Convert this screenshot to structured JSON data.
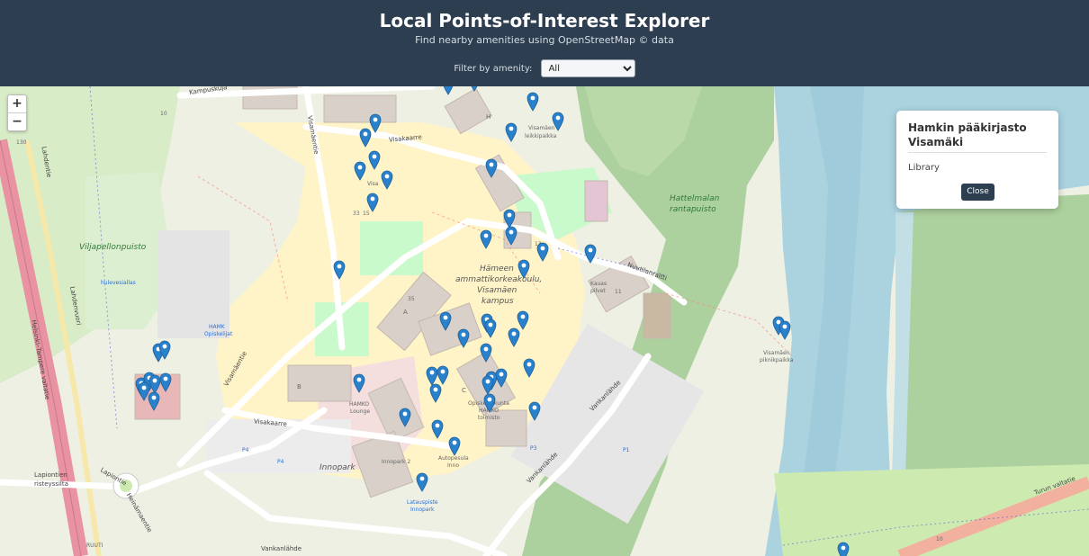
{
  "header": {
    "title": "Local Points-of-Interest Explorer",
    "subtitle": "Find nearby amenities using OpenStreetMap © data",
    "filter_label": "Filter by amenity:",
    "filter_value": "All"
  },
  "map": {
    "zoom_in": "+",
    "zoom_out": "−",
    "area_labels": {
      "viljapellonpuisto": "Viljapellonpuisto",
      "hattelmalan_1": "Hattelmalan",
      "hattelmalan_2": "rantapuisto",
      "hamk_1": "Hämeen",
      "hamk_2": "ammattikorkeakoulu,",
      "hamk_3": "Visamäen",
      "hamk_4": "kampus",
      "innopark": "Innopark",
      "lapiontien_1": "Lapiontien",
      "lapiontien_2": "risteyssilta"
    },
    "road_labels": {
      "kampuskuja": "Kampuskuja",
      "visakaarre_top": "Visakaarre",
      "visakaarre_bottom": "Visakaarre",
      "visamaentie_left": "Visamäentie",
      "visamaentie_top": "Visamäentie",
      "vankanlahde_1": "Vankanlähde",
      "vankanlahde_2": "Vankanlähde",
      "vankanlahde_3": "Vankanlähde",
      "nuutilanraitti": "Nuutilanraitti",
      "turun_valtatie": "Turun valtatie",
      "lahdentie": "Lahdentie",
      "lahdenvuori": "Lahdenvuori",
      "helsinki_tampere": "Helsinki–Tampere valtatie",
      "lapiontie": "Lapiontie",
      "heinamaentie": "Heinämaentie"
    },
    "small_labels": {
      "visamaen_leikkipaikka_1": "Visamäen",
      "visamaen_leikkipaikka_2": "leikkipaikka",
      "visamaen_piknikpaikka_1": "Visamäen",
      "visamaen_piknikpaikka_2": "piknikpaikka",
      "hamko_lounge_1": "HAMKO",
      "hamko_lounge_2": "Lounge",
      "hamk_opiskelijat_1": "HAMK",
      "hamk_opiskelijat_2": "Opiskelijat",
      "kauas_pilvet_1": "Kauas",
      "kauas_pilvet_2": "pilvet",
      "autopesula_1": "Autopesula",
      "autopesula_2": "Inno",
      "opiskelijakunta_1": "Opiskelijakunta",
      "opiskelijakunta_2": "HAMKO",
      "opiskelijakunta_3": "toimisto",
      "latauspiste_1": "Latauspiste",
      "latauspiste_2": "Innopark",
      "hulevesiallas": "hulevesiallas",
      "p1": "P1",
      "p3": "P3",
      "p4a": "P4",
      "p4b": "P4",
      "number_130": "130",
      "number_10a": "10",
      "number_10b": "10",
      "number_13": "13",
      "number_35": "35",
      "number_11": "11",
      "number_33": "33",
      "number_15": "15",
      "letter_b": "B",
      "letter_h": "H",
      "letter_c": "C",
      "letter_a": "A",
      "ruuti": "RUUTI",
      "innopark_2": "Innopark 2",
      "visa": "Visa"
    }
  },
  "popup": {
    "title": "Hamkin pääkirjasto Visamäki",
    "type": "Library",
    "close_label": "Close"
  },
  "colors": {
    "header_bg": "#2c3e50",
    "marker_blue": "#2a81cb",
    "water": "#aad3df",
    "park": "#c8facc",
    "forest": "#add19e",
    "campus": "#fffbe0",
    "road_major": "#e892a2"
  }
}
